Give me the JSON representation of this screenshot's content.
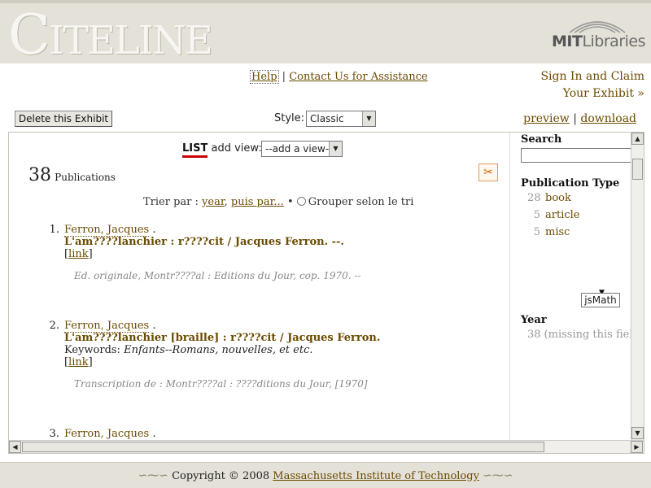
{
  "header": {
    "logo_text": "Citeline",
    "partner_logo_prefix": "MIT",
    "partner_logo_suffix": "Libraries"
  },
  "top_links": {
    "help": "Help",
    "separator": "|",
    "contact": "Contact Us for Assistance",
    "sign_in": "Sign In and Claim Your Exhibit »"
  },
  "toolbar": {
    "delete_label": "Delete this Exhibit",
    "style_label": "Style:",
    "style_selected": "Classic",
    "preview": "preview",
    "separator": "|",
    "download": "download"
  },
  "view": {
    "list_label": "LIST",
    "add_view_label": "add view:",
    "add_view_selected": "--add a view--",
    "count": "38",
    "count_label": "Publications",
    "sort_prefix": "Trier par :",
    "sort_field": "year",
    "sort_then": "puis par...",
    "sort_bullet": "•",
    "group_label": "Grouper selon le tri"
  },
  "records": [
    {
      "num": "1.",
      "author": "Ferron, Jacques",
      "author_suffix": " .",
      "title": "L'am????lanchier : r????cit / Jacques Ferron. --.",
      "link_open": "[",
      "link": "link",
      "link_close": "]",
      "note": "Ed. originale, Montr????al : Editions du Jour, cop. 1970. --"
    },
    {
      "num": "2.",
      "author": "Ferron, Jacques",
      "author_suffix": " .",
      "title": "L'am????lanchier [braille] : r????cit / Jacques Ferron.",
      "keywords_label": "Keywords: ",
      "keywords": "Enfants--Romans, nouvelles, et etc.",
      "link_open": "[",
      "link": "link",
      "link_close": "]",
      "note": "Transcription de : Montr????al : ????ditions du Jour, [1970]"
    },
    {
      "num": "3.",
      "author": "Ferron, Jacques",
      "author_suffix": " ."
    }
  ],
  "sidebar": {
    "search_label": "Search",
    "pubtype_label": "Publication Type",
    "pubtypes": [
      {
        "count": "28",
        "label": "book"
      },
      {
        "count": "5",
        "label": "article"
      },
      {
        "count": "5",
        "label": "misc"
      }
    ],
    "year_label": "Year",
    "year_missing_count": "38",
    "year_missing_label": "(missing this field)"
  },
  "jsmath_label": "jsMath",
  "footer": {
    "copyright": "Copyright © 2008 ",
    "org": "Massachusetts Institute of Technology"
  }
}
